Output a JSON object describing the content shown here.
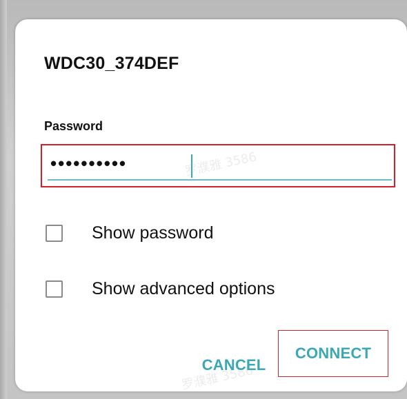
{
  "dialog": {
    "title": "WDC30_374DEF",
    "password_label": "Password",
    "password_value": "••••••••••",
    "options": [
      {
        "label": "Show password",
        "checked": false
      },
      {
        "label": "Show advanced options",
        "checked": false
      }
    ],
    "buttons": {
      "cancel": "CANCEL",
      "connect": "CONNECT"
    }
  },
  "watermark": {
    "text_1": "罗濮雅 3586",
    "text_2": "罗濮雅 3586"
  },
  "colors": {
    "accent": "#3ba7b7",
    "highlight_red": "#d0212a",
    "text": "#111111",
    "checkbox_border": "#8a8a8a",
    "background": "#c7c7c7"
  }
}
